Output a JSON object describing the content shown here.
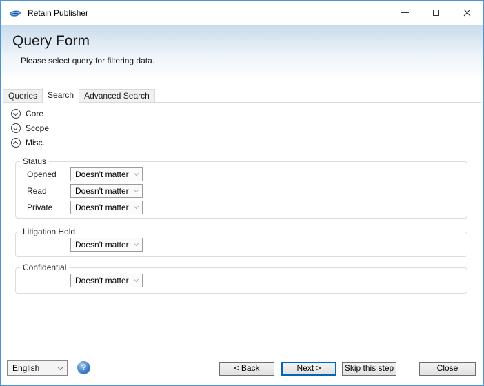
{
  "window": {
    "title": "Retain Publisher"
  },
  "header": {
    "title": "Query Form",
    "subtitle": "Please select query for filtering data."
  },
  "tabs": [
    {
      "label": "Queries",
      "selected": false
    },
    {
      "label": "Search",
      "selected": true
    },
    {
      "label": "Advanced Search",
      "selected": false
    }
  ],
  "search_tab": {
    "expanders": [
      {
        "label": "Core",
        "state": "collapsed"
      },
      {
        "label": "Scope",
        "state": "collapsed"
      },
      {
        "label": "Misc.",
        "state": "expanded"
      }
    ],
    "misc": {
      "groups": [
        {
          "legend": "Status",
          "rows": [
            {
              "label": "Opened",
              "value": "Doesn't matter"
            },
            {
              "label": "Read",
              "value": "Doesn't matter"
            },
            {
              "label": "Private",
              "value": "Doesn't matter"
            }
          ]
        },
        {
          "legend": "Litigation Hold",
          "rows": [
            {
              "label": "",
              "value": "Doesn't matter"
            }
          ]
        },
        {
          "legend": "Confidential",
          "rows": [
            {
              "label": "",
              "value": "Doesn't matter"
            }
          ]
        }
      ]
    }
  },
  "footer": {
    "language": "English",
    "help": "?",
    "back": "< Back",
    "next": "Next >",
    "skip": "Skip this step",
    "close": "Close"
  },
  "colors": {
    "window_border": "#4a94d8",
    "header_gradient_top": "#c9dbeb",
    "default_button_border": "#0166b6",
    "help_icon_blue": "#4485cd"
  }
}
